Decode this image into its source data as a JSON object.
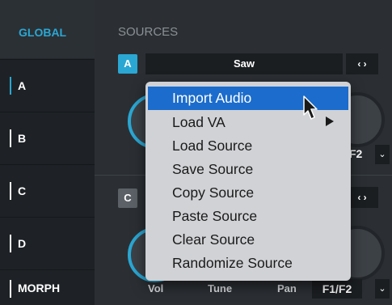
{
  "sidebar": {
    "global_label": "GLOBAL",
    "items": [
      {
        "label": "A",
        "active": true
      },
      {
        "label": "B",
        "active": false
      },
      {
        "label": "C",
        "active": false
      },
      {
        "label": "D",
        "active": false
      },
      {
        "label": "MORPH",
        "active": false
      }
    ]
  },
  "main": {
    "section_title": "SOURCES",
    "source_a": {
      "letter": "A",
      "source_name": "Saw",
      "nav_arrows": "‹ ›"
    },
    "source_c": {
      "letter": "C",
      "nav_arrows": "‹ ›"
    },
    "filter_top": {
      "value_partial": "F2",
      "dropdown": "⌄"
    },
    "params": {
      "vol": "Vol",
      "tune": "Tune",
      "pan": "Pan",
      "filter": "F1/F2",
      "dropdown": "⌄"
    }
  },
  "context_menu": {
    "items": [
      {
        "label": "Import Audio",
        "highlighted": true,
        "has_submenu": false
      },
      {
        "label": "Load VA",
        "highlighted": false,
        "has_submenu": true
      },
      {
        "label": "Load Source",
        "highlighted": false,
        "has_submenu": false
      },
      {
        "label": "Save Source",
        "highlighted": false,
        "has_submenu": false
      },
      {
        "label": "Copy Source",
        "highlighted": false,
        "has_submenu": false
      },
      {
        "label": "Paste Source",
        "highlighted": false,
        "has_submenu": false
      },
      {
        "label": "Clear Source",
        "highlighted": false,
        "has_submenu": false
      },
      {
        "label": "Randomize Source",
        "highlighted": false,
        "has_submenu": false
      }
    ]
  },
  "colors": {
    "accent": "#2aa7d3",
    "menu_highlight": "#1b6ccc",
    "menu_bg": "#d0d2d5"
  },
  "icons": {
    "cursor": "arrow-pointer-icon",
    "submenu": "triangle-right-icon"
  }
}
